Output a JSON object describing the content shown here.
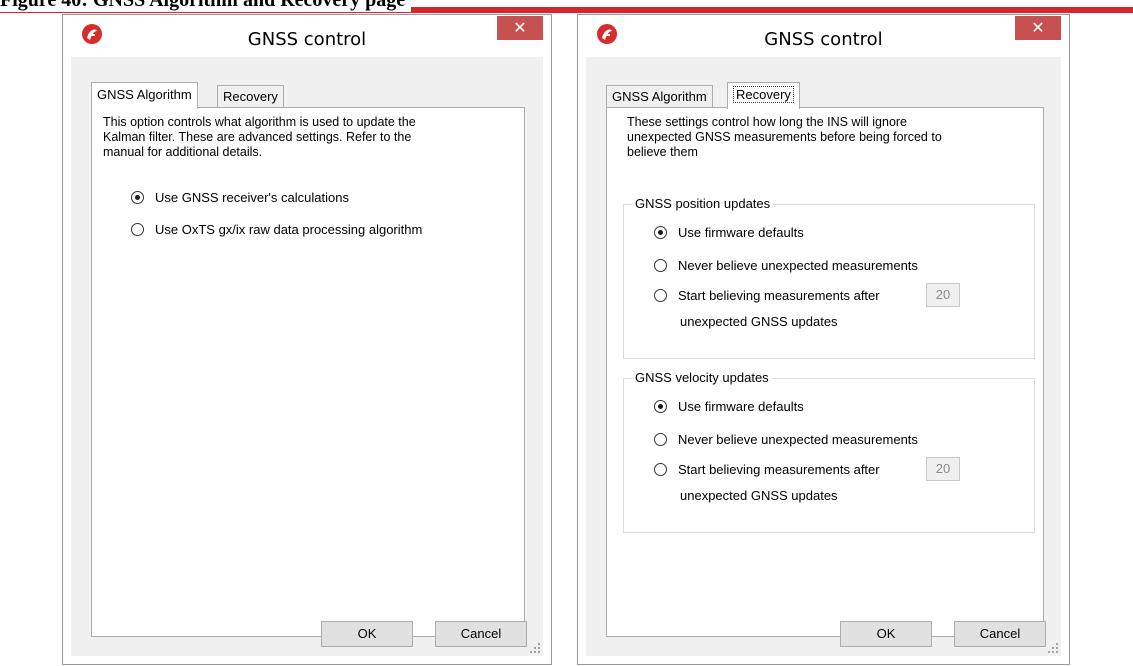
{
  "page": {
    "heading": "Figure 40: GNSS Algorithm and Recovery page"
  },
  "accent": {
    "heading_rule": "#d6262d",
    "close_button": "#c75050"
  },
  "left_dialog": {
    "title": "GNSS control",
    "close_glyph": "✕",
    "tabs": [
      {
        "label": "GNSS Algorithm",
        "active": true
      },
      {
        "label": "Recovery",
        "active": false
      }
    ],
    "description": "This option controls what algorithm is used to update the\nKalman filter.  These are advanced settings.  Refer to the\nmanual for additional details.",
    "options": [
      {
        "label": "Use GNSS receiver's calculations",
        "selected": true
      },
      {
        "label": "Use OxTS gx/ix raw data processing algorithm",
        "selected": false
      }
    ],
    "ok_label": "OK",
    "cancel_label": "Cancel"
  },
  "right_dialog": {
    "title": "GNSS control",
    "close_glyph": "✕",
    "tabs": [
      {
        "label": "GNSS Algorithm",
        "active": false
      },
      {
        "label": "Recovery",
        "active": true
      }
    ],
    "description": "These settings control how long the INS will ignore\nunexpected GNSS measurements before being forced to\nbelieve them",
    "position_group": {
      "label": "GNSS position updates",
      "options": [
        {
          "label": "Use firmware defaults",
          "selected": true
        },
        {
          "label": "Never believe unexpected measurements",
          "selected": false
        },
        {
          "label": "Start believing measurements after",
          "selected": false
        }
      ],
      "count_value": "20",
      "count_suffix": "unexpected GNSS updates"
    },
    "velocity_group": {
      "label": "GNSS velocity updates",
      "options": [
        {
          "label": "Use firmware defaults",
          "selected": true
        },
        {
          "label": "Never believe unexpected measurements",
          "selected": false
        },
        {
          "label": "Start believing measurements after",
          "selected": false
        }
      ],
      "count_value": "20",
      "count_suffix": "unexpected GNSS updates"
    },
    "ok_label": "OK",
    "cancel_label": "Cancel"
  },
  "icons": {
    "app": "oxts-logo-icon",
    "close": "close-icon",
    "grip": "resize-grip-icon"
  }
}
